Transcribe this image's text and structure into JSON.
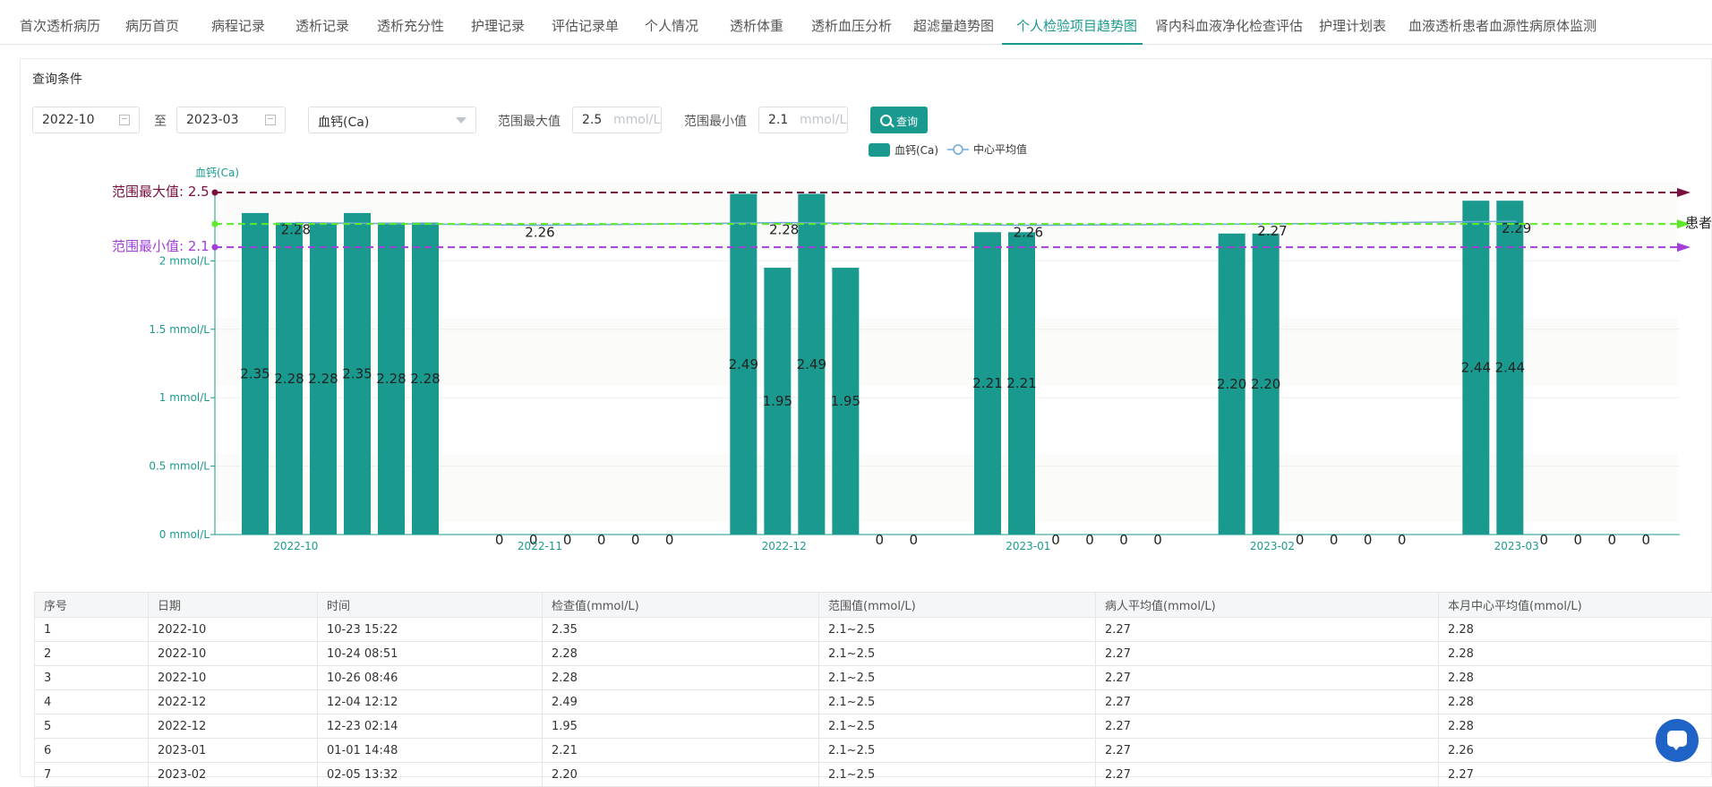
{
  "tabs": [
    {
      "label": "首次透析病历",
      "active": false
    },
    {
      "label": "病历首页",
      "active": false
    },
    {
      "label": "病程记录",
      "active": false
    },
    {
      "label": "透析记录",
      "active": false
    },
    {
      "label": "透析充分性",
      "active": false
    },
    {
      "label": "护理记录",
      "active": false
    },
    {
      "label": "评估记录单",
      "active": false
    },
    {
      "label": "个人情况",
      "active": false
    },
    {
      "label": "透析体重",
      "active": false
    },
    {
      "label": "透析血压分析",
      "active": false
    },
    {
      "label": "超滤量趋势图",
      "active": false
    },
    {
      "label": "个人检验项目趋势图",
      "active": true
    },
    {
      "label": "肾内科血液净化检查评估",
      "active": false
    },
    {
      "label": "护理计划表",
      "active": false
    },
    {
      "label": "血液透析患者血源性病原体监测",
      "active": false
    }
  ],
  "query": {
    "title": "查询条件",
    "start_month": "2022-10",
    "to_label": "至",
    "end_month": "2023-03",
    "item_selected": "血钙(Ca)",
    "max_label": "范围最大值",
    "max_value": "2.5",
    "max_unit": "mmol/L",
    "min_label": "范围最小值",
    "min_value": "2.1",
    "min_unit": "mmol/L",
    "button_label": "查询"
  },
  "chart_data": {
    "type": "bar",
    "title": "",
    "ylabel": "血钙(Ca)",
    "ylim": [
      0,
      2.5
    ],
    "y_ticks": [
      "0 mmol/L",
      "0.5 mmol/L",
      "1 mmol/L",
      "1.5 mmol/L",
      "2 mmol/L"
    ],
    "y_tick_values": [
      0,
      0.5,
      1,
      1.5,
      2
    ],
    "x_month_labels": [
      "2022-10",
      "2022-11",
      "2022-12",
      "2023-01",
      "2023-02",
      "2023-03"
    ],
    "legend": [
      "血钙(Ca)",
      "中心平均值"
    ],
    "legend_position": "top",
    "bar_color": "#1a9a8e",
    "months": [
      {
        "label": "2022-10",
        "values": [
          2.35,
          2.28,
          2.28,
          2.35,
          2.28,
          2.28
        ],
        "center_avg": 2.28
      },
      {
        "label": "2022-11",
        "values": [
          0,
          0,
          0,
          0,
          0,
          0
        ],
        "center_avg": 2.26
      },
      {
        "label": "2022-12",
        "values": [
          2.49,
          1.95,
          2.49,
          1.95,
          0,
          0
        ],
        "center_avg": 2.28
      },
      {
        "label": "2023-01",
        "values": [
          2.21,
          2.21,
          0,
          0,
          0,
          0
        ],
        "center_avg": 2.26
      },
      {
        "label": "2023-02",
        "values": [
          2.2,
          2.2,
          0,
          0,
          0,
          0
        ],
        "center_avg": 2.27
      },
      {
        "label": "2023-03",
        "values": [
          2.44,
          2.44,
          0,
          0,
          0,
          0
        ],
        "center_avg": 2.29
      }
    ],
    "ref_lines": [
      {
        "label": "范围最大值: 2.5",
        "value": 2.5,
        "color": "#7a1040"
      },
      {
        "label": "范围最小值: 2.1",
        "value": 2.1,
        "color": "#a23fd8"
      },
      {
        "label": "患者",
        "value": 2.27,
        "color": "#5ee82a"
      }
    ]
  },
  "table": {
    "columns": [
      "序号",
      "日期",
      "时间",
      "检查值(mmol/L)",
      "范围值(mmol/L)",
      "病人平均值(mmol/L)",
      "本月中心平均值(mmol/L)"
    ],
    "rows": [
      [
        "1",
        "2022-10",
        "10-23 15:22",
        "2.35",
        "2.1~2.5",
        "2.27",
        "2.28"
      ],
      [
        "2",
        "2022-10",
        "10-24 08:51",
        "2.28",
        "2.1~2.5",
        "2.27",
        "2.28"
      ],
      [
        "3",
        "2022-10",
        "10-26 08:46",
        "2.28",
        "2.1~2.5",
        "2.27",
        "2.28"
      ],
      [
        "4",
        "2022-12",
        "12-04 12:12",
        "2.49",
        "2.1~2.5",
        "2.27",
        "2.28"
      ],
      [
        "5",
        "2022-12",
        "12-23 02:14",
        "1.95",
        "2.1~2.5",
        "2.27",
        "2.28"
      ],
      [
        "6",
        "2023-01",
        "01-01 14:48",
        "2.21",
        "2.1~2.5",
        "2.27",
        "2.26"
      ],
      [
        "7",
        "2023-02",
        "02-05 13:32",
        "2.20",
        "2.1~2.5",
        "2.27",
        "2.27"
      ]
    ]
  },
  "colors": {
    "accent": "#1a9a8e",
    "chat": "#1f63c6"
  },
  "icons": [
    "calendar-icon",
    "caret-down-icon",
    "search-icon",
    "chat-icon"
  ]
}
